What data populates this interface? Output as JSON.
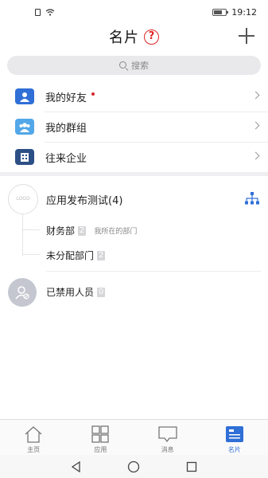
{
  "status_bar": {
    "time": "19:12"
  },
  "header": {
    "title": "名片",
    "help_glyph": "?"
  },
  "search": {
    "placeholder": "搜索"
  },
  "menu": [
    {
      "label": "我的好友",
      "has_dot": true,
      "icon": "friends-icon"
    },
    {
      "label": "我的群组",
      "has_dot": false,
      "icon": "groups-icon"
    },
    {
      "label": "往来企业",
      "has_dot": false,
      "icon": "company-icon"
    }
  ],
  "org": {
    "logo_text": "LOGO",
    "title": "应用发布测试(4)",
    "departments": [
      {
        "name": "财务部",
        "count": "2",
        "note": "我所在的部门"
      },
      {
        "name": "未分配部门",
        "count": "2",
        "note": ""
      }
    ]
  },
  "disabled": {
    "label": "已禁用人员",
    "count": "0"
  },
  "tabs": [
    {
      "label": "主页",
      "icon": "home-icon",
      "active": false
    },
    {
      "label": "应用",
      "icon": "apps-grid-icon",
      "active": false
    },
    {
      "label": "消息",
      "icon": "message-icon",
      "active": false
    },
    {
      "label": "名片",
      "icon": "card-icon",
      "active": true
    }
  ],
  "colors": {
    "accent": "#2f6fd6",
    "help_red": "#e02424"
  }
}
